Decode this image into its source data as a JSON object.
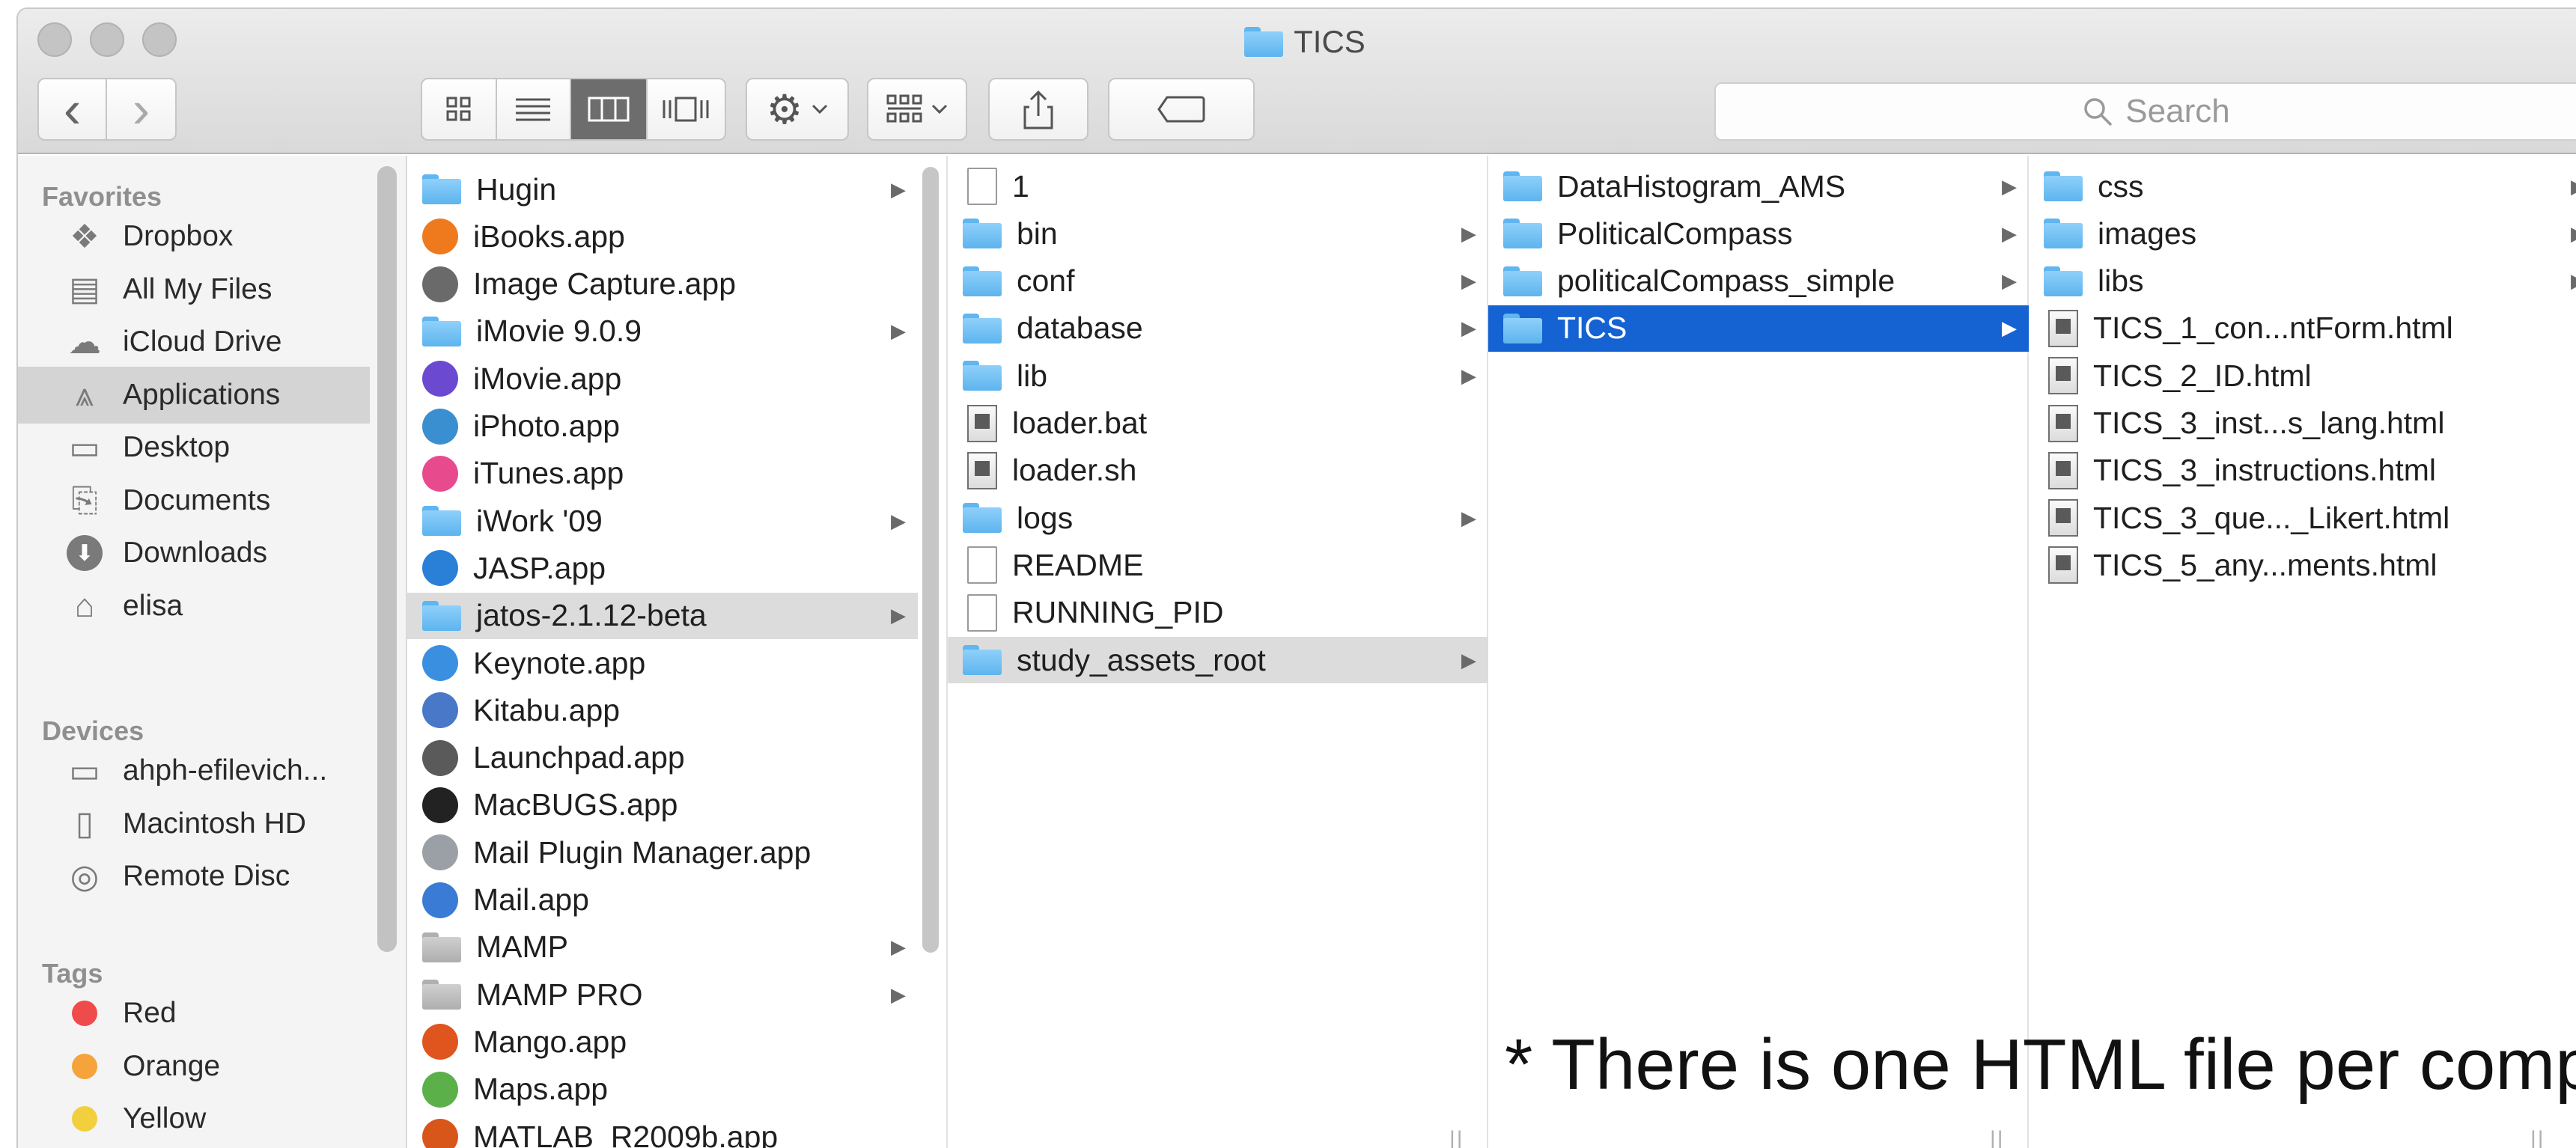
{
  "window": {
    "title": "TICS"
  },
  "toolbar": {
    "search_placeholder": "Search",
    "back_glyph": "‹",
    "forward_glyph": "›"
  },
  "sidebar": {
    "favorites_label": "Favorites",
    "favorites": [
      {
        "label": "Dropbox",
        "icon": "dropbox-icon"
      },
      {
        "label": "All My Files",
        "icon": "all-files-icon"
      },
      {
        "label": "iCloud Drive",
        "icon": "cloud-icon"
      },
      {
        "label": "Applications",
        "icon": "applications-icon",
        "selected": true
      },
      {
        "label": "Desktop",
        "icon": "desktop-icon"
      },
      {
        "label": "Documents",
        "icon": "documents-icon"
      },
      {
        "label": "Downloads",
        "icon": "downloads-icon"
      },
      {
        "label": "elisa",
        "icon": "home-icon"
      }
    ],
    "devices_label": "Devices",
    "devices": [
      {
        "label": "ahph-efilevich...",
        "icon": "laptop-icon"
      },
      {
        "label": "Macintosh HD",
        "icon": "hard-drive-icon"
      },
      {
        "label": "Remote Disc",
        "icon": "disc-icon"
      }
    ],
    "tags_label": "Tags",
    "tags": [
      {
        "label": "Red",
        "color": "#f04b4b"
      },
      {
        "label": "Orange",
        "color": "#f5a33a"
      },
      {
        "label": "Yellow",
        "color": "#f2cf3c"
      }
    ]
  },
  "columns": {
    "applications": [
      {
        "label": "Hugin",
        "kind": "folder",
        "arrow": true
      },
      {
        "label": "iBooks.app",
        "kind": "app",
        "color": "#ef7a1e"
      },
      {
        "label": "Image Capture.app",
        "kind": "app",
        "color": "#6a6a6a"
      },
      {
        "label": "iMovie 9.0.9",
        "kind": "folder",
        "arrow": true
      },
      {
        "label": "iMovie.app",
        "kind": "app",
        "color": "#6b4ad1"
      },
      {
        "label": "iPhoto.app",
        "kind": "app",
        "color": "#3a8fd0"
      },
      {
        "label": "iTunes.app",
        "kind": "app",
        "color": "#e84a8e"
      },
      {
        "label": "iWork '09",
        "kind": "folder",
        "arrow": true
      },
      {
        "label": "JASP.app",
        "kind": "app",
        "color": "#2a7fd6"
      },
      {
        "label": "jatos-2.1.12-beta",
        "kind": "folder",
        "arrow": true,
        "selected": "gray"
      },
      {
        "label": "Keynote.app",
        "kind": "app",
        "color": "#3b8fe0"
      },
      {
        "label": "Kitabu.app",
        "kind": "app",
        "color": "#4a78c8"
      },
      {
        "label": "Launchpad.app",
        "kind": "app",
        "color": "#5a5a5a"
      },
      {
        "label": "MacBUGS.app",
        "kind": "app",
        "color": "#222222"
      },
      {
        "label": "Mail Plugin Manager.app",
        "kind": "app",
        "color": "#9aa0a6"
      },
      {
        "label": "Mail.app",
        "kind": "app",
        "color": "#3a7bd5"
      },
      {
        "label": "MAMP",
        "kind": "folder-gray",
        "arrow": true
      },
      {
        "label": "MAMP PRO",
        "kind": "folder-gray",
        "arrow": true
      },
      {
        "label": "Mango.app",
        "kind": "app",
        "color": "#e0541e"
      },
      {
        "label": "Maps.app",
        "kind": "app",
        "color": "#5bb04a"
      },
      {
        "label": "MATLAB_R2009b.app",
        "kind": "app",
        "color": "#d9561b"
      }
    ],
    "jatos": [
      {
        "label": "1",
        "kind": "doc"
      },
      {
        "label": "bin",
        "kind": "folder",
        "arrow": true
      },
      {
        "label": "conf",
        "kind": "folder",
        "arrow": true
      },
      {
        "label": "database",
        "kind": "folder",
        "arrow": true
      },
      {
        "label": "lib",
        "kind": "folder",
        "arrow": true
      },
      {
        "label": "loader.bat",
        "kind": "script"
      },
      {
        "label": "loader.sh",
        "kind": "script"
      },
      {
        "label": "logs",
        "kind": "folder",
        "arrow": true
      },
      {
        "label": "README",
        "kind": "doc"
      },
      {
        "label": "RUNNING_PID",
        "kind": "doc"
      },
      {
        "label": "study_assets_root",
        "kind": "folder",
        "arrow": true,
        "selected": "gray"
      }
    ],
    "study_assets": [
      {
        "label": "DataHistogram_AMS",
        "kind": "folder",
        "arrow": true
      },
      {
        "label": "PoliticalCompass",
        "kind": "folder",
        "arrow": true
      },
      {
        "label": "politicalCompass_simple",
        "kind": "folder",
        "arrow": true
      },
      {
        "label": "TICS",
        "kind": "folder",
        "arrow": true,
        "selected": "blue"
      }
    ],
    "tics": [
      {
        "label": "css",
        "kind": "folder",
        "arrow": true
      },
      {
        "label": "images",
        "kind": "folder",
        "arrow": true
      },
      {
        "label": "libs",
        "kind": "folder",
        "arrow": true
      },
      {
        "label": "TICS_1_con...ntForm.html",
        "kind": "html"
      },
      {
        "label": "TICS_2_ID.html",
        "kind": "html"
      },
      {
        "label": "TICS_3_inst...s_lang.html",
        "kind": "html"
      },
      {
        "label": "TICS_3_instructions.html",
        "kind": "html"
      },
      {
        "label": "TICS_3_que..._Likert.html",
        "kind": "html"
      },
      {
        "label": "TICS_5_any...ments.html",
        "kind": "html"
      }
    ]
  },
  "annotation": {
    "text": "*  There is one HTML file per compo"
  }
}
